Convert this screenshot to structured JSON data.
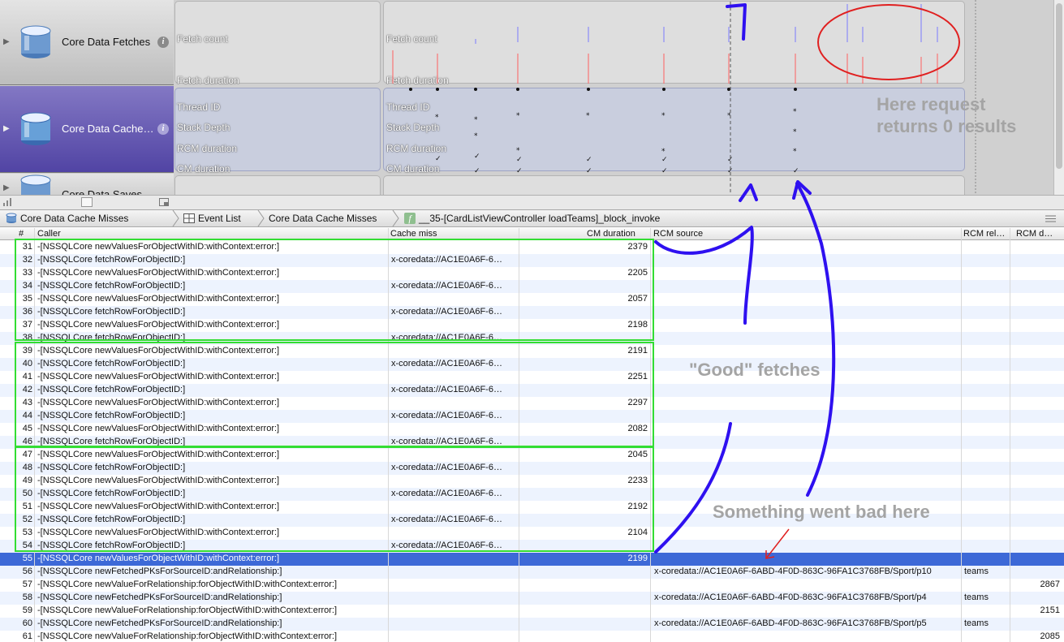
{
  "tracks": [
    {
      "name": "Core Data Fetches",
      "labels": [
        "Fetch count",
        "Fetch duration"
      ]
    },
    {
      "name": "Core Data Cache…",
      "labels": [
        "Thread ID",
        "Stack Depth",
        "RCM duration",
        "CM duration"
      ]
    },
    {
      "name": "Core Data Saves",
      "labels": []
    }
  ],
  "info_glyph": "i",
  "breadcrumb": {
    "instrument": "Core Data Cache Misses",
    "view": "Event List",
    "detail": "Core Data Cache Misses",
    "function_badge": "f",
    "function": "__35-[CardListViewController loadTeams]_block_invoke"
  },
  "columns": {
    "num": "#",
    "caller": "Caller",
    "miss": "Cache miss",
    "dur": "CM duration",
    "rcm": "RCM source",
    "rel": "RCM rel…",
    "rcmd": "RCM d…"
  },
  "rows": [
    {
      "n": "31",
      "caller": "-[NSSQLCore newValuesForObjectWithID:withContext:error:]",
      "miss": "",
      "dur": "2379",
      "rcm": "",
      "rel": "",
      "rcmd": ""
    },
    {
      "n": "32",
      "caller": "-[NSSQLCore fetchRowForObjectID:]",
      "miss": "x-coredata://AC1E0A6F-6…",
      "dur": "",
      "rcm": "",
      "rel": "",
      "rcmd": ""
    },
    {
      "n": "33",
      "caller": "-[NSSQLCore newValuesForObjectWithID:withContext:error:]",
      "miss": "",
      "dur": "2205",
      "rcm": "",
      "rel": "",
      "rcmd": ""
    },
    {
      "n": "34",
      "caller": "-[NSSQLCore fetchRowForObjectID:]",
      "miss": "x-coredata://AC1E0A6F-6…",
      "dur": "",
      "rcm": "",
      "rel": "",
      "rcmd": ""
    },
    {
      "n": "35",
      "caller": "-[NSSQLCore newValuesForObjectWithID:withContext:error:]",
      "miss": "",
      "dur": "2057",
      "rcm": "",
      "rel": "",
      "rcmd": ""
    },
    {
      "n": "36",
      "caller": "-[NSSQLCore fetchRowForObjectID:]",
      "miss": "x-coredata://AC1E0A6F-6…",
      "dur": "",
      "rcm": "",
      "rel": "",
      "rcmd": ""
    },
    {
      "n": "37",
      "caller": "-[NSSQLCore newValuesForObjectWithID:withContext:error:]",
      "miss": "",
      "dur": "2198",
      "rcm": "",
      "rel": "",
      "rcmd": ""
    },
    {
      "n": "38",
      "caller": "-[NSSQLCore fetchRowForObjectID:]",
      "miss": "x-coredata://AC1E0A6F-6…",
      "dur": "",
      "rcm": "",
      "rel": "",
      "rcmd": ""
    },
    {
      "n": "39",
      "caller": "-[NSSQLCore newValuesForObjectWithID:withContext:error:]",
      "miss": "",
      "dur": "2191",
      "rcm": "",
      "rel": "",
      "rcmd": ""
    },
    {
      "n": "40",
      "caller": "-[NSSQLCore fetchRowForObjectID:]",
      "miss": "x-coredata://AC1E0A6F-6…",
      "dur": "",
      "rcm": "",
      "rel": "",
      "rcmd": ""
    },
    {
      "n": "41",
      "caller": "-[NSSQLCore newValuesForObjectWithID:withContext:error:]",
      "miss": "",
      "dur": "2251",
      "rcm": "",
      "rel": "",
      "rcmd": ""
    },
    {
      "n": "42",
      "caller": "-[NSSQLCore fetchRowForObjectID:]",
      "miss": "x-coredata://AC1E0A6F-6…",
      "dur": "",
      "rcm": "",
      "rel": "",
      "rcmd": ""
    },
    {
      "n": "43",
      "caller": "-[NSSQLCore newValuesForObjectWithID:withContext:error:]",
      "miss": "",
      "dur": "2297",
      "rcm": "",
      "rel": "",
      "rcmd": ""
    },
    {
      "n": "44",
      "caller": "-[NSSQLCore fetchRowForObjectID:]",
      "miss": "x-coredata://AC1E0A6F-6…",
      "dur": "",
      "rcm": "",
      "rel": "",
      "rcmd": ""
    },
    {
      "n": "45",
      "caller": "-[NSSQLCore newValuesForObjectWithID:withContext:error:]",
      "miss": "",
      "dur": "2082",
      "rcm": "",
      "rel": "",
      "rcmd": ""
    },
    {
      "n": "46",
      "caller": "-[NSSQLCore fetchRowForObjectID:]",
      "miss": "x-coredata://AC1E0A6F-6…",
      "dur": "",
      "rcm": "",
      "rel": "",
      "rcmd": ""
    },
    {
      "n": "47",
      "caller": "-[NSSQLCore newValuesForObjectWithID:withContext:error:]",
      "miss": "",
      "dur": "2045",
      "rcm": "",
      "rel": "",
      "rcmd": ""
    },
    {
      "n": "48",
      "caller": "-[NSSQLCore fetchRowForObjectID:]",
      "miss": "x-coredata://AC1E0A6F-6…",
      "dur": "",
      "rcm": "",
      "rel": "",
      "rcmd": ""
    },
    {
      "n": "49",
      "caller": "-[NSSQLCore newValuesForObjectWithID:withContext:error:]",
      "miss": "",
      "dur": "2233",
      "rcm": "",
      "rel": "",
      "rcmd": ""
    },
    {
      "n": "50",
      "caller": "-[NSSQLCore fetchRowForObjectID:]",
      "miss": "x-coredata://AC1E0A6F-6…",
      "dur": "",
      "rcm": "",
      "rel": "",
      "rcmd": ""
    },
    {
      "n": "51",
      "caller": "-[NSSQLCore newValuesForObjectWithID:withContext:error:]",
      "miss": "",
      "dur": "2192",
      "rcm": "",
      "rel": "",
      "rcmd": ""
    },
    {
      "n": "52",
      "caller": "-[NSSQLCore fetchRowForObjectID:]",
      "miss": "x-coredata://AC1E0A6F-6…",
      "dur": "",
      "rcm": "",
      "rel": "",
      "rcmd": ""
    },
    {
      "n": "53",
      "caller": "-[NSSQLCore newValuesForObjectWithID:withContext:error:]",
      "miss": "",
      "dur": "2104",
      "rcm": "",
      "rel": "",
      "rcmd": ""
    },
    {
      "n": "54",
      "caller": "-[NSSQLCore fetchRowForObjectID:]",
      "miss": "x-coredata://AC1E0A6F-6…",
      "dur": "",
      "rcm": "",
      "rel": "",
      "rcmd": ""
    },
    {
      "n": "55",
      "caller": "-[NSSQLCore newValuesForObjectWithID:withContext:error:]",
      "miss": "",
      "dur": "2199",
      "rcm": "",
      "rel": "",
      "rcmd": "",
      "selected": true
    },
    {
      "n": "56",
      "caller": "-[NSSQLCore newFetchedPKsForSourceID:andRelationship:]",
      "miss": "",
      "dur": "",
      "rcm": "x-coredata://AC1E0A6F-6ABD-4F0D-863C-96FA1C3768FB/Sport/p10",
      "rel": "teams",
      "rcmd": ""
    },
    {
      "n": "57",
      "caller": "-[NSSQLCore newValueForRelationship:forObjectWithID:withContext:error:]",
      "miss": "",
      "dur": "",
      "rcm": "",
      "rel": "",
      "rcmd": "2867"
    },
    {
      "n": "58",
      "caller": "-[NSSQLCore newFetchedPKsForSourceID:andRelationship:]",
      "miss": "",
      "dur": "",
      "rcm": "x-coredata://AC1E0A6F-6ABD-4F0D-863C-96FA1C3768FB/Sport/p4",
      "rel": "teams",
      "rcmd": ""
    },
    {
      "n": "59",
      "caller": "-[NSSQLCore newValueForRelationship:forObjectWithID:withContext:error:]",
      "miss": "",
      "dur": "",
      "rcm": "",
      "rel": "",
      "rcmd": "2151"
    },
    {
      "n": "60",
      "caller": "-[NSSQLCore newFetchedPKsForSourceID:andRelationship:]",
      "miss": "",
      "dur": "",
      "rcm": "x-coredata://AC1E0A6F-6ABD-4F0D-863C-96FA1C3768FB/Sport/p5",
      "rel": "teams",
      "rcmd": ""
    },
    {
      "n": "61",
      "caller": "-[NSSQLCore newValueForRelationship:forObjectWithID:withContext:error:]",
      "miss": "",
      "dur": "",
      "rcm": "",
      "rel": "",
      "rcmd": "2085"
    }
  ],
  "annotations": {
    "here_request": "Here request",
    "returns_zero": "returns 0 results",
    "good_fetches": "\"Good\" fetches",
    "went_bad": "Something went bad here"
  },
  "colors": {
    "selection": "#3d69d7",
    "stripe": "#edf3fe",
    "green_box": "#33dd33",
    "pen_blue": "#2e10f0",
    "red_marker": "#e02020",
    "fetch_count_tick": "#7a7aff",
    "fetch_duration_tick": "#ff6060"
  }
}
